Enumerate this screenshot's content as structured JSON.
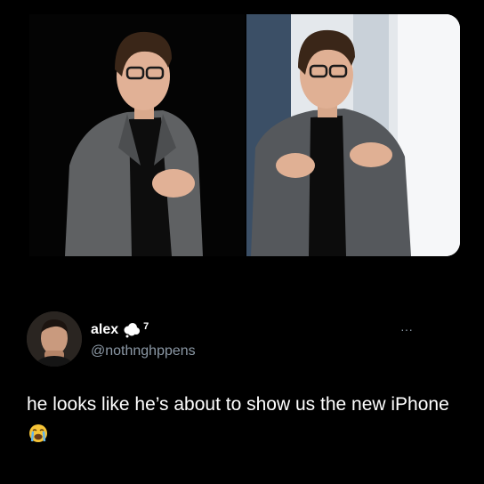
{
  "tweet": {
    "display_name": "alex",
    "badge_count": "7",
    "handle": "@nothnghppens",
    "text": "he looks like he’s about to show us the new iPhone",
    "more_menu": "···"
  },
  "media": [
    {
      "description_icon": "photo-speaker-dark-stage"
    },
    {
      "description_icon": "photo-speaker-light-stage"
    }
  ],
  "colors": {
    "background": "#000000",
    "text": "#ffffff",
    "secondary_text": "#8b98a5",
    "emoji_face": "#f6c437"
  }
}
